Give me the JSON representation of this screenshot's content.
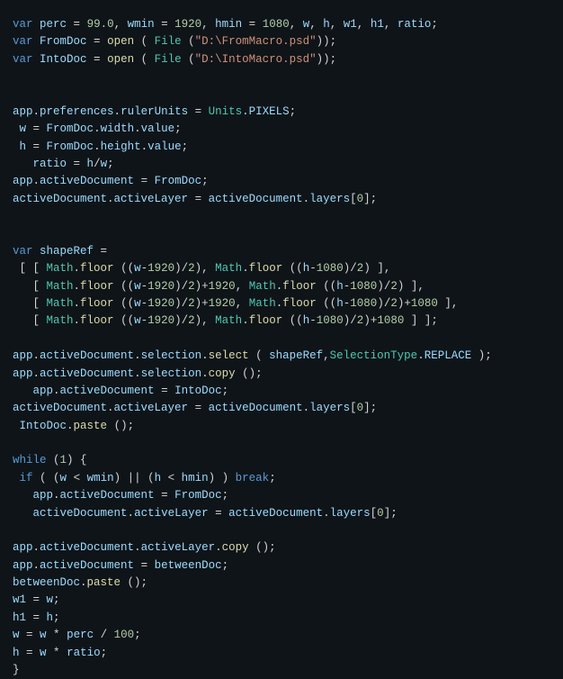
{
  "code": {
    "perc_val": "99.0",
    "wmin_val": "1920",
    "hmin_val": "1080",
    "path1": "\"D:\\FromMacro.psd\"",
    "path2": "\"D:\\IntoMacro.psd\"",
    "kw_var": "var",
    "kw_while": "while",
    "kw_if": "if",
    "kw_break": "break",
    "v_perc": "perc",
    "v_wmin": "wmin",
    "v_hmin": "hmin",
    "v_w": "w",
    "v_h": "h",
    "v_w1": "w1",
    "v_h1": "h1",
    "v_ratio": "ratio",
    "v_FromDoc": "FromDoc",
    "v_IntoDoc": "IntoDoc",
    "v_betweenDoc": "betweenDoc",
    "v_app": "app",
    "v_activeDocument": "activeDocument",
    "v_shapeRef": "shapeRef",
    "f_open": "open",
    "f_File": "File",
    "f_floor": "floor",
    "f_select": "select",
    "f_copy": "copy",
    "f_paste": "paste",
    "t_Math": "Math",
    "t_Units": "Units",
    "t_SelectionType": "SelectionType",
    "p_preferences": "preferences",
    "p_rulerUnits": "rulerUnits",
    "p_PIXELS": "PIXELS",
    "p_width": "width",
    "p_height": "height",
    "p_value": "value",
    "p_activeLayer": "activeLayer",
    "p_layers": "layers",
    "p_selection": "selection",
    "p_REPLACE": "REPLACE",
    "n_1920": "1920",
    "n_1080": "1080",
    "n_2": "2",
    "n_0": "0",
    "n_1": "1",
    "n_100": "100"
  }
}
